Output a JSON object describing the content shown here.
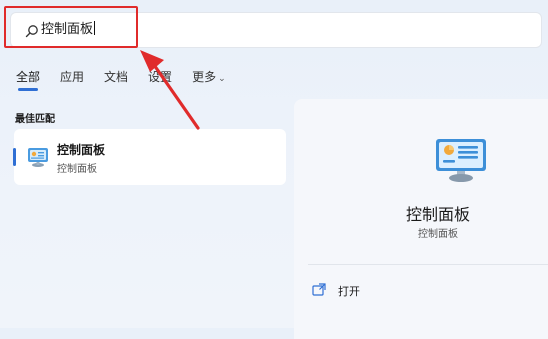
{
  "search": {
    "value": "控制面板",
    "icon": "search-icon"
  },
  "tabs": [
    {
      "label": "全部",
      "active": true
    },
    {
      "label": "应用",
      "active": false
    },
    {
      "label": "文档",
      "active": false
    },
    {
      "label": "设置",
      "active": false
    },
    {
      "label": "更多",
      "active": false
    }
  ],
  "best_match": {
    "section_title": "最佳匹配",
    "title": "控制面板",
    "subtitle": "控制面板",
    "icon": "control-panel-icon"
  },
  "detail": {
    "title": "控制面板",
    "subtitle": "控制面板",
    "icon": "control-panel-icon",
    "actions": [
      {
        "label": "打开",
        "icon": "open-icon"
      }
    ]
  },
  "colors": {
    "accent": "#2f6fd4",
    "highlight": "#e02b2b"
  }
}
